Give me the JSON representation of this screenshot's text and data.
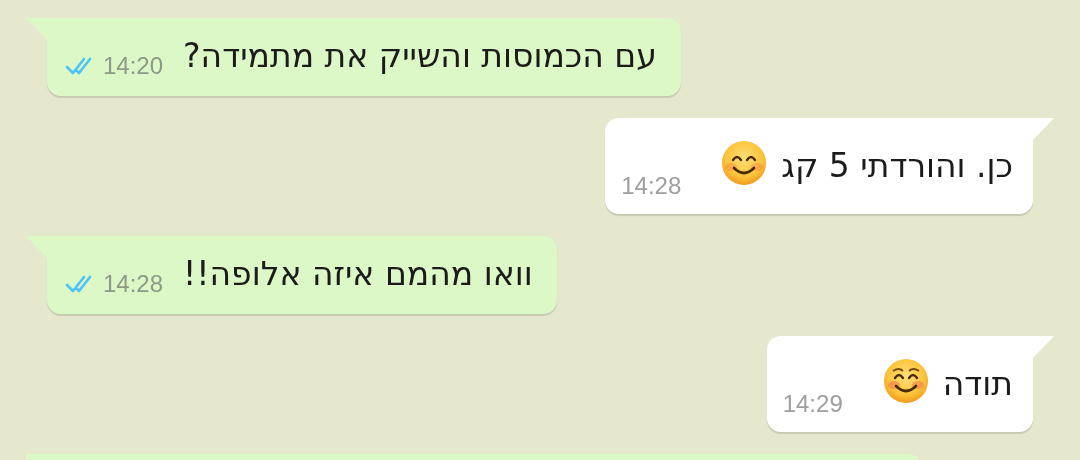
{
  "messages": [
    {
      "kind": "sent",
      "text": "עם הכמוסות והשייק את מתמידה?",
      "time": "14:20",
      "read": true
    },
    {
      "kind": "received",
      "text": "כן. והורדתי 5 קג",
      "emoji": {
        "kind": "smile"
      },
      "time": "14:28"
    },
    {
      "kind": "sent",
      "text": "וואו מהמם איזה אלופה!!",
      "time": "14:28",
      "read": true
    },
    {
      "kind": "received",
      "text": "תודה",
      "emoji": {
        "kind": "blush"
      },
      "time": "14:29"
    }
  ],
  "next_message_cut_off": true
}
